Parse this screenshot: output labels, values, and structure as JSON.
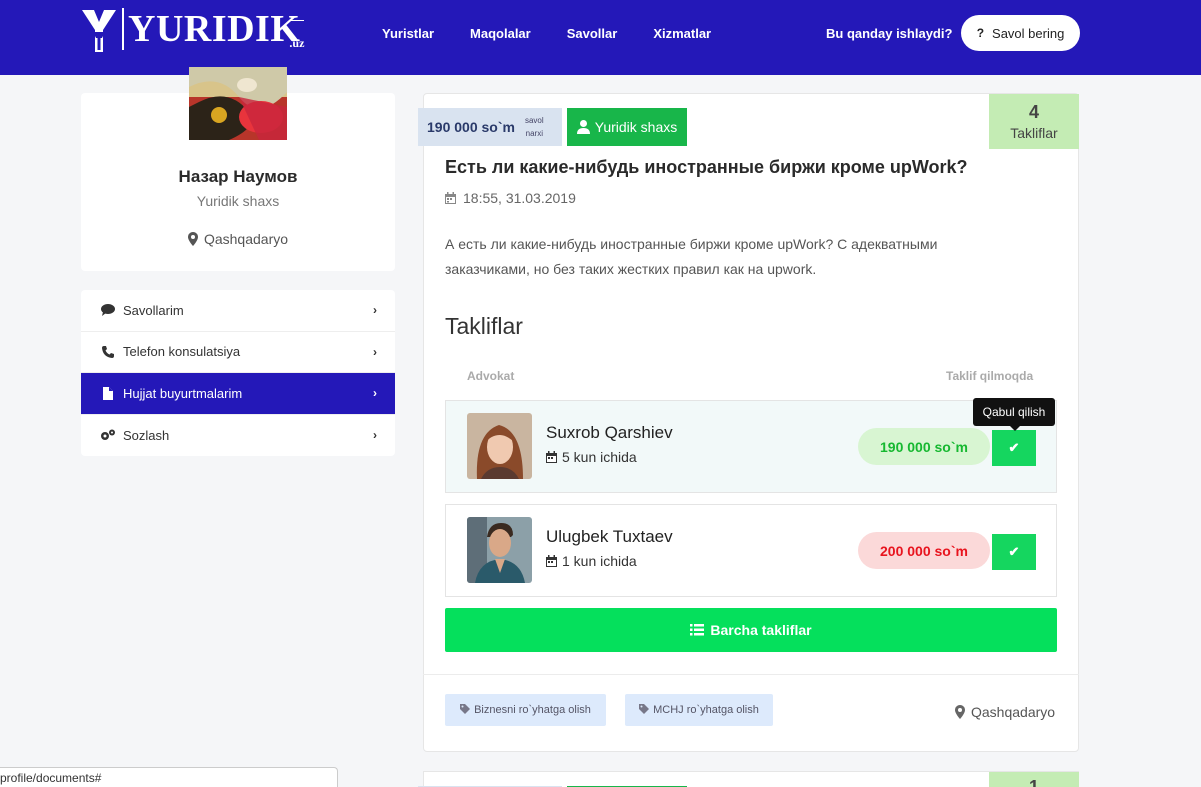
{
  "header": {
    "logo_text": "YURIDIK",
    "logo_suffix": ".uz",
    "nav": [
      "Yuristlar",
      "Maqolalar",
      "Savollar",
      "Xizmatlar"
    ],
    "how_it_works": "Bu qanday ishlaydi?",
    "ask_button": "Savol bering",
    "ask_button_icon": "?"
  },
  "profile": {
    "name": "Назар Наумов",
    "type": "Yuridik shaxs",
    "location": "Qashqadaryo"
  },
  "menu": [
    {
      "label": "Savollarim",
      "icon": "comment-icon",
      "active": false
    },
    {
      "label": "Telefon konsulatsiya",
      "icon": "phone-icon",
      "active": false
    },
    {
      "label": "Hujjat buyurtmalarim",
      "icon": "document-icon",
      "active": true
    },
    {
      "label": "Sozlash",
      "icon": "gears-icon",
      "active": false
    }
  ],
  "question": {
    "price": "190 000 so`m",
    "price_label_1": "savol",
    "price_label_2": "narxi",
    "entity_badge": "Yuridik shaxs",
    "offers_count": "4",
    "offers_count_label": "Takliflar",
    "title": "Есть ли какие-нибудь иностранные биржи кроме upWork?",
    "date": "18:55, 31.03.2019",
    "body": "А есть ли какие-нибудь иностранные биржи кроме upWork? С адекватными заказчиками, но без таких жестких правил как на upwork."
  },
  "offers_section": {
    "heading": "Takliflar",
    "col_lawyer": "Advokat",
    "col_offer": "Taklif qilmoqda",
    "tooltip": "Qabul qilish",
    "offers": [
      {
        "name": "Suxrob Qarshiev",
        "days": "5 kun ichida",
        "price": "190 000 so`m",
        "price_color": "green"
      },
      {
        "name": "Ulugbek Tuxtaev",
        "days": "1 kun ichida",
        "price": "200 000 so`m",
        "price_color": "red"
      }
    ],
    "all_button": "Barcha takliflar"
  },
  "tags": [
    "Biznesni ro`yhatga olish",
    "MCHJ ro`yhatga olish"
  ],
  "footer_location": "Qashqadaryo",
  "next_card_count": "1",
  "status_url": "profile/documents#",
  "colors": {
    "header_bg": "#2418b8",
    "accent_green": "#05e05c",
    "badge_green": "#18b64a",
    "count_bg": "#c4ecb4",
    "price_red": "#e8141e"
  }
}
